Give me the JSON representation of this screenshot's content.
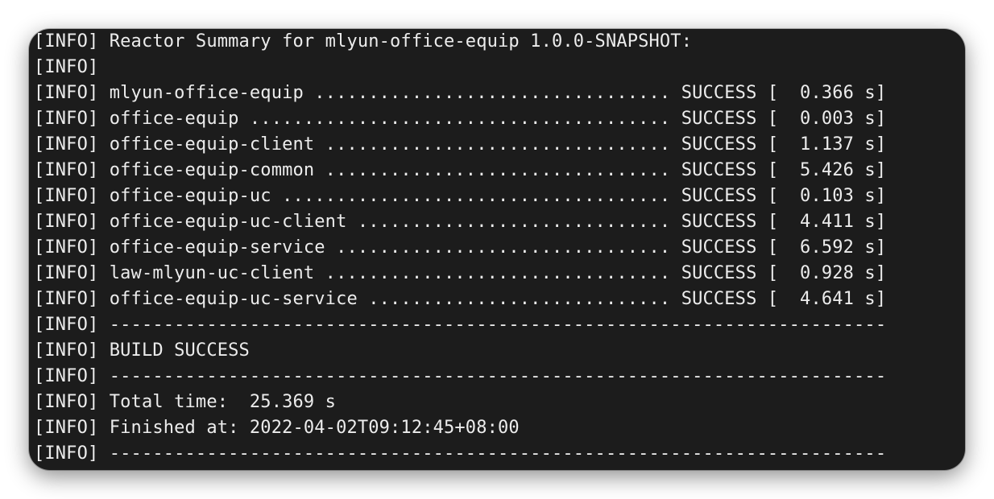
{
  "terminal": {
    "lines": [
      "[INFO] Reactor Summary for mlyun-office-equip 1.0.0-SNAPSHOT:",
      "[INFO]",
      "[INFO] mlyun-office-equip ................................. SUCCESS [  0.366 s]",
      "[INFO] office-equip ....................................... SUCCESS [  0.003 s]",
      "[INFO] office-equip-client ................................ SUCCESS [  1.137 s]",
      "[INFO] office-equip-common ................................ SUCCESS [  5.426 s]",
      "[INFO] office-equip-uc .................................... SUCCESS [  0.103 s]",
      "[INFO] office-equip-uc-client ............................. SUCCESS [  4.411 s]",
      "[INFO] office-equip-service ............................... SUCCESS [  6.592 s]",
      "[INFO] law-mlyun-uc-client ................................ SUCCESS [  0.928 s]",
      "[INFO] office-equip-uc-service ............................ SUCCESS [  4.641 s]",
      "[INFO] ------------------------------------------------------------------------",
      "[INFO] BUILD SUCCESS",
      "[INFO] ------------------------------------------------------------------------",
      "[INFO] Total time:  25.369 s",
      "[INFO] Finished at: 2022-04-02T09:12:45+08:00",
      "[INFO] ------------------------------------------------------------------------"
    ]
  }
}
